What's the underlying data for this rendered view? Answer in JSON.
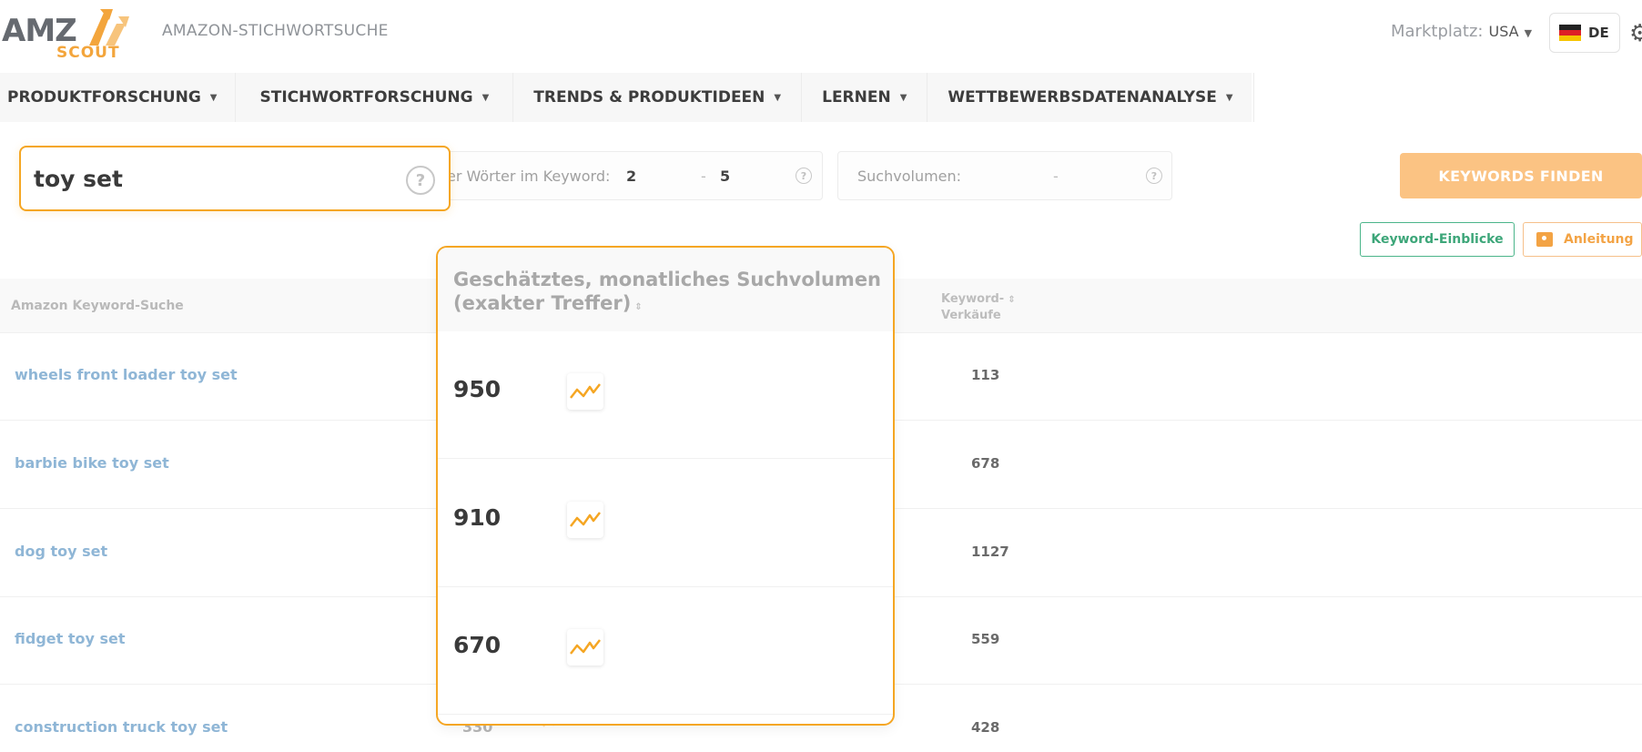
{
  "app": {
    "logo_main": "AMZ",
    "logo_sub": "SCOUT",
    "title": "AMAZON-STICHWORTSUCHE",
    "marketplace_label": "Marktplatz:",
    "marketplace_value": "USA",
    "language": "DE"
  },
  "nav": [
    {
      "label": "PRODUKTFORSCHUNG"
    },
    {
      "label": "STICHWORTFORSCHUNG"
    },
    {
      "label": "TRENDS & PRODUKTIDEEN"
    },
    {
      "label": "LERNEN"
    },
    {
      "label": "WETTBEWERBSDATENANALYSE"
    }
  ],
  "search": {
    "value": "toy set",
    "help": "?"
  },
  "filters": {
    "words_label": "er Wörter im Keyword:",
    "words_min": "2",
    "words_sep": "-",
    "words_max": "5",
    "volume_label": "Suchvolumen:",
    "volume_sep": "-",
    "help": "?"
  },
  "buttons": {
    "find": "KEYWORDS FINDEN",
    "insights": "Keyword-Einblicke",
    "guide": "Anleitung"
  },
  "table": {
    "col_keyword": "Amazon Keyword-Suche",
    "col_volume": "Geschätztes, monatliches Suchvolumen (exakter Treffer)",
    "col_sales_line1": "Keyword-",
    "col_sales_line2": "Verkäufe",
    "rows": [
      {
        "keyword": "wheels front loader toy set",
        "volume": "950",
        "sales": "113"
      },
      {
        "keyword": "barbie bike toy set",
        "volume": "910",
        "sales": "678"
      },
      {
        "keyword": "dog toy set",
        "volume": "670",
        "sales": "1127"
      },
      {
        "keyword": "fidget toy set",
        "volume": "",
        "sales": "559"
      },
      {
        "keyword": "construction truck toy set",
        "volume": "330",
        "sales": "428"
      }
    ]
  },
  "colors": {
    "accent_orange": "#f5a623",
    "keyword_link": "#8fb6d6",
    "insight_green": "#3da679"
  },
  "icons": [
    "settings-gear-icon",
    "germany-flag-icon",
    "help-circle-icon",
    "trend-chart-icon",
    "sort-icon",
    "caret-down-icon",
    "guide-chat-icon"
  ]
}
